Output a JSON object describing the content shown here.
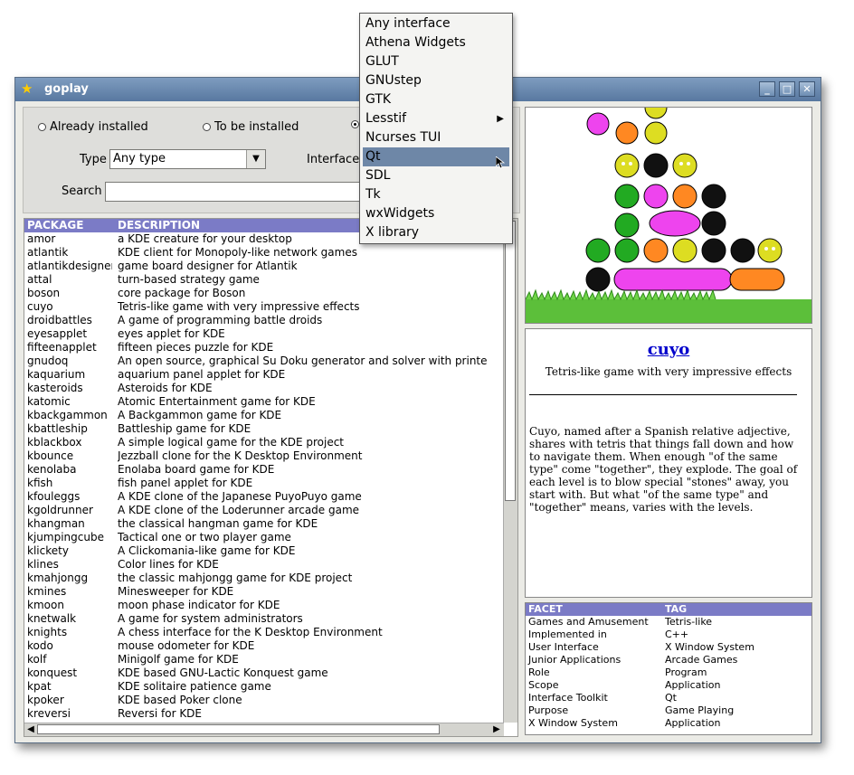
{
  "window": {
    "title": "goplay"
  },
  "filters": {
    "radios": [
      {
        "label": "Already installed",
        "selected": false
      },
      {
        "label": "To be installed",
        "selected": false
      },
      {
        "label": "",
        "selected": true
      }
    ],
    "type_label": "Type",
    "type_value": "Any type",
    "interface_label": "Interface",
    "search_label": "Search",
    "search_value": ""
  },
  "table": {
    "headers": {
      "package": "PACKAGE",
      "description": "DESCRIPTION"
    },
    "rows": [
      [
        "amor",
        "a KDE creature for your desktop"
      ],
      [
        "atlantik",
        "KDE client for Monopoly-like network games"
      ],
      [
        "atlantikdesigner",
        "game board designer for Atlantik"
      ],
      [
        "attal",
        "turn-based strategy game"
      ],
      [
        "boson",
        "core package for Boson"
      ],
      [
        "cuyo",
        "Tetris-like game with very impressive effects"
      ],
      [
        "droidbattles",
        "A game of programming battle droids"
      ],
      [
        "eyesapplet",
        "eyes applet for KDE"
      ],
      [
        "fifteenapplet",
        "fifteen pieces puzzle for KDE"
      ],
      [
        "gnudoq",
        "An open source, graphical Su Doku generator and solver with printe"
      ],
      [
        "kaquarium",
        "aquarium panel applet for KDE"
      ],
      [
        "kasteroids",
        "Asteroids for KDE"
      ],
      [
        "katomic",
        "Atomic Entertainment game for KDE"
      ],
      [
        "kbackgammon",
        "A Backgammon game for KDE"
      ],
      [
        "kbattleship",
        "Battleship game for KDE"
      ],
      [
        "kblackbox",
        "A simple logical game for the KDE project"
      ],
      [
        "kbounce",
        "Jezzball clone for the K Desktop Environment"
      ],
      [
        "kenolaba",
        "Enolaba board game for KDE"
      ],
      [
        "kfish",
        "fish panel applet for KDE"
      ],
      [
        "kfouleggs",
        "A KDE clone of the Japanese PuyoPuyo game"
      ],
      [
        "kgoldrunner",
        "A KDE clone of the Loderunner arcade game"
      ],
      [
        "khangman",
        "the classical hangman game for KDE"
      ],
      [
        "kjumpingcube",
        "Tactical one or two player game"
      ],
      [
        "klickety",
        "A Clickomania-like game for KDE"
      ],
      [
        "klines",
        "Color lines for KDE"
      ],
      [
        "kmahjongg",
        "the classic mahjongg game for KDE project"
      ],
      [
        "kmines",
        "Minesweeper for KDE"
      ],
      [
        "kmoon",
        "moon phase indicator for KDE"
      ],
      [
        "knetwalk",
        "A game for system administrators"
      ],
      [
        "knights",
        "A chess interface for the K Desktop Environment"
      ],
      [
        "kodo",
        "mouse odometer for KDE"
      ],
      [
        "kolf",
        "Minigolf game for KDE"
      ],
      [
        "konquest",
        "KDE based GNU-Lactic Konquest game"
      ],
      [
        "kpat",
        "KDE solitaire patience game"
      ],
      [
        "kpoker",
        "KDE based Poker clone"
      ],
      [
        "kreversi",
        "Reversi for KDE"
      ]
    ]
  },
  "details": {
    "name": "cuyo",
    "short": "Tetris-like game with very impressive effects",
    "long": "Cuyo, named after a Spanish relative adjective, shares with tetris that things fall down and how to navigate them. When enough \"of the same type\" come \"together\", they explode. The goal of each level is to blow special \"stones\" away, you start with. But what \"of the same type\" and \"together\" means, varies with the levels."
  },
  "facets": {
    "headers": {
      "facet": "FACET",
      "tag": "TAG"
    },
    "rows": [
      [
        "Games and Amusement",
        "Tetris-like"
      ],
      [
        "Implemented in",
        "C++"
      ],
      [
        "User Interface",
        "X Window System"
      ],
      [
        "Junior Applications",
        "Arcade Games"
      ],
      [
        "Role",
        "Program"
      ],
      [
        "Scope",
        "Application"
      ],
      [
        "Interface Toolkit",
        "Qt"
      ],
      [
        "Purpose",
        "Game Playing"
      ],
      [
        "X Window System",
        "Application"
      ]
    ]
  },
  "interface_menu": {
    "items": [
      "Any interface",
      "Athena Widgets",
      "GLUT",
      "GNUstep",
      "GTK",
      "Lesstif",
      "Ncurses TUI",
      "Qt",
      "SDL",
      "Tk",
      "wxWidgets",
      "X library"
    ],
    "selected": "Qt",
    "submenu_item": "Lesstif"
  },
  "colors": {
    "header": "#7b7bc6",
    "titlebar": "#6d8db3",
    "selection": "#6e87a7",
    "link": "#0000cc"
  }
}
